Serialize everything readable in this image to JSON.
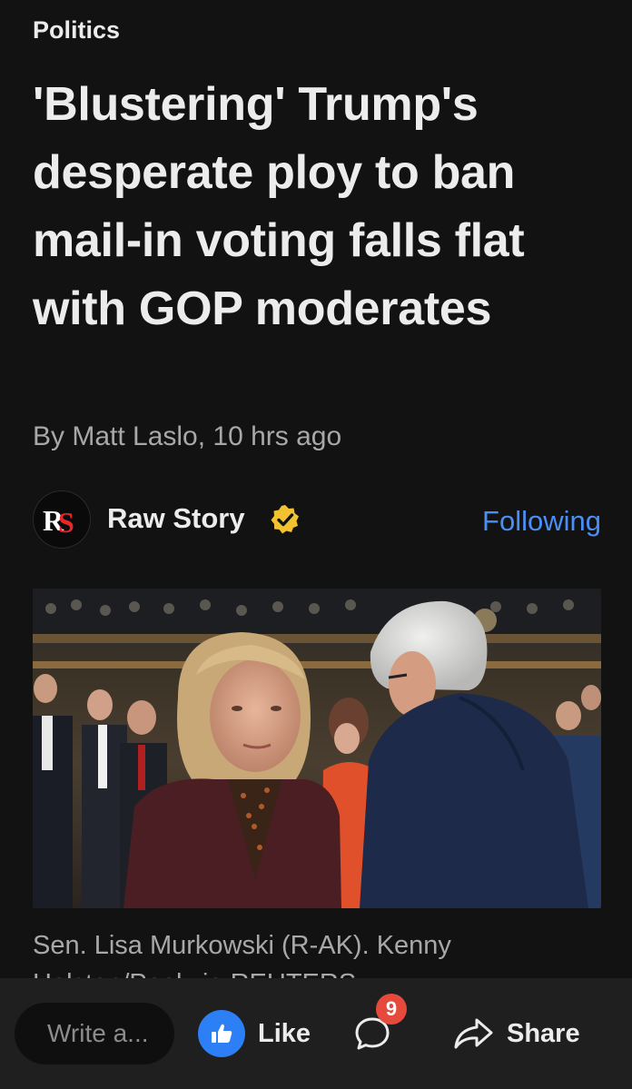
{
  "article": {
    "category": "Politics",
    "headline": "'Blustering' Trump's desperate ploy to ban mail-in voting falls flat with GOP moderates",
    "byline": "By Matt Laslo,  10 hrs ago"
  },
  "source": {
    "logo_text": "RS",
    "name": "Raw Story",
    "follow_label": "Following"
  },
  "photo": {
    "caption": "Sen. Lisa Murkowski (R-AK). Kenny Holston/Pool via REUTERS"
  },
  "actions": {
    "comment_placeholder": "Write a...",
    "like_label": "Like",
    "comment_count": "9",
    "share_label": "Share"
  },
  "colors": {
    "background": "#121212",
    "accent_link": "#4a8ff5",
    "like_blue": "#2d7ff5",
    "badge_red": "#e64a3c",
    "verified_gold": "#f2c230"
  },
  "icons": {
    "verified": "verified-badge-icon",
    "like": "thumbs-up-icon",
    "comment": "speech-bubble-icon",
    "share": "share-arrow-icon"
  }
}
